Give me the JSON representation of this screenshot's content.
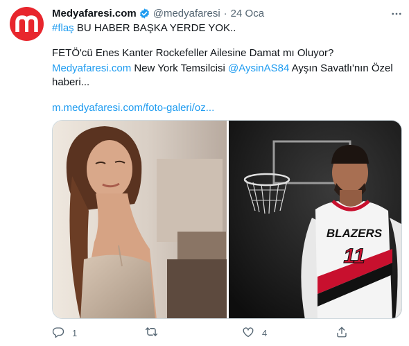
{
  "author": {
    "name": "Medyafaresi.com",
    "handle": "@medyafaresi",
    "separator": "·",
    "time": "24 Oca",
    "avatar_letter": "m"
  },
  "tweet": {
    "line1_hashtag": "#flaş",
    "line1_text": " BU HABER  BAŞKA YERDE YOK..",
    "line2": "FETÖ'cü Enes Kanter Rockefeller Ailesine Damat mı Oluyor?",
    "line3_link1": "Medyafaresi.com",
    "line3_text1": " New York Temsilcisi ",
    "line3_mention": "@AysinAS84",
    "line3_text2": " Ayşın Savatlı'nın Özel",
    "line4": "haberi...",
    "url": "m.medyafaresi.com/foto-galeri/oz..."
  },
  "media": {
    "jersey_word": "BLAZERS",
    "jersey_number": "11"
  },
  "actions": {
    "reply_count": "1",
    "retweet_count": "",
    "like_count": "4"
  },
  "colors": {
    "accent": "#1d9bf0",
    "avatar": "#e8262d",
    "secondary_text": "#536471"
  },
  "icons": [
    "verified-badge-icon",
    "more-options-icon",
    "reply-icon",
    "retweet-icon",
    "like-icon",
    "share-icon"
  ]
}
